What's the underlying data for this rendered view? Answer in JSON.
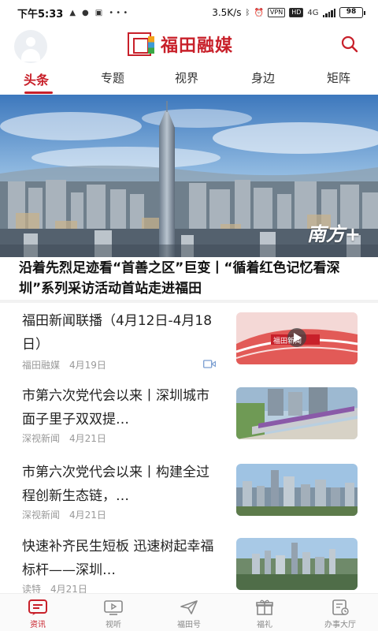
{
  "status_bar": {
    "time": "下午5:33",
    "network_speed": "3.5K/s",
    "vpn_label": "VPN",
    "hd_label": "HD",
    "network_type": "4G",
    "battery": "98"
  },
  "header": {
    "brand_name": "福田融媒"
  },
  "tabs": [
    {
      "label": "头条",
      "active": true
    },
    {
      "label": "专题",
      "active": false
    },
    {
      "label": "视界",
      "active": false
    },
    {
      "label": "身边",
      "active": false
    },
    {
      "label": "矩阵",
      "active": false
    }
  ],
  "hero": {
    "watermark": "南方+",
    "title": "沿着先烈足迹看“首善之区”巨变丨“循着红色记忆看深圳”系列采访活动首站走进福田"
  },
  "news": [
    {
      "title": "福田新闻联播（4月12日-4月18日）",
      "source": "福田融媒",
      "date": "4月19日",
      "has_video": true,
      "thumb_caption": "福田新闻"
    },
    {
      "title": "市第六次党代会以来丨深圳城市面子里子双双提…",
      "source": "深视新闻",
      "date": "4月21日",
      "has_video": false
    },
    {
      "title": "市第六次党代会以来丨构建全过程创新生态链，…",
      "source": "深视新闻",
      "date": "4月21日",
      "has_video": false
    },
    {
      "title": "快速补齐民生短板 迅速树起幸福标杆——深圳…",
      "source": "读特",
      "date": "4月21日",
      "has_video": false
    }
  ],
  "bottom_nav": [
    {
      "label": "资讯",
      "icon": "news-icon",
      "active": true
    },
    {
      "label": "视听",
      "icon": "tv-icon",
      "active": false
    },
    {
      "label": "福田号",
      "icon": "paper-plane-icon",
      "active": false
    },
    {
      "label": "福礼",
      "icon": "gift-icon",
      "active": false
    },
    {
      "label": "办事大厅",
      "icon": "service-hall-icon",
      "active": false
    }
  ],
  "colors": {
    "brand_red": "#c8202a",
    "meta_gray": "#999999"
  }
}
